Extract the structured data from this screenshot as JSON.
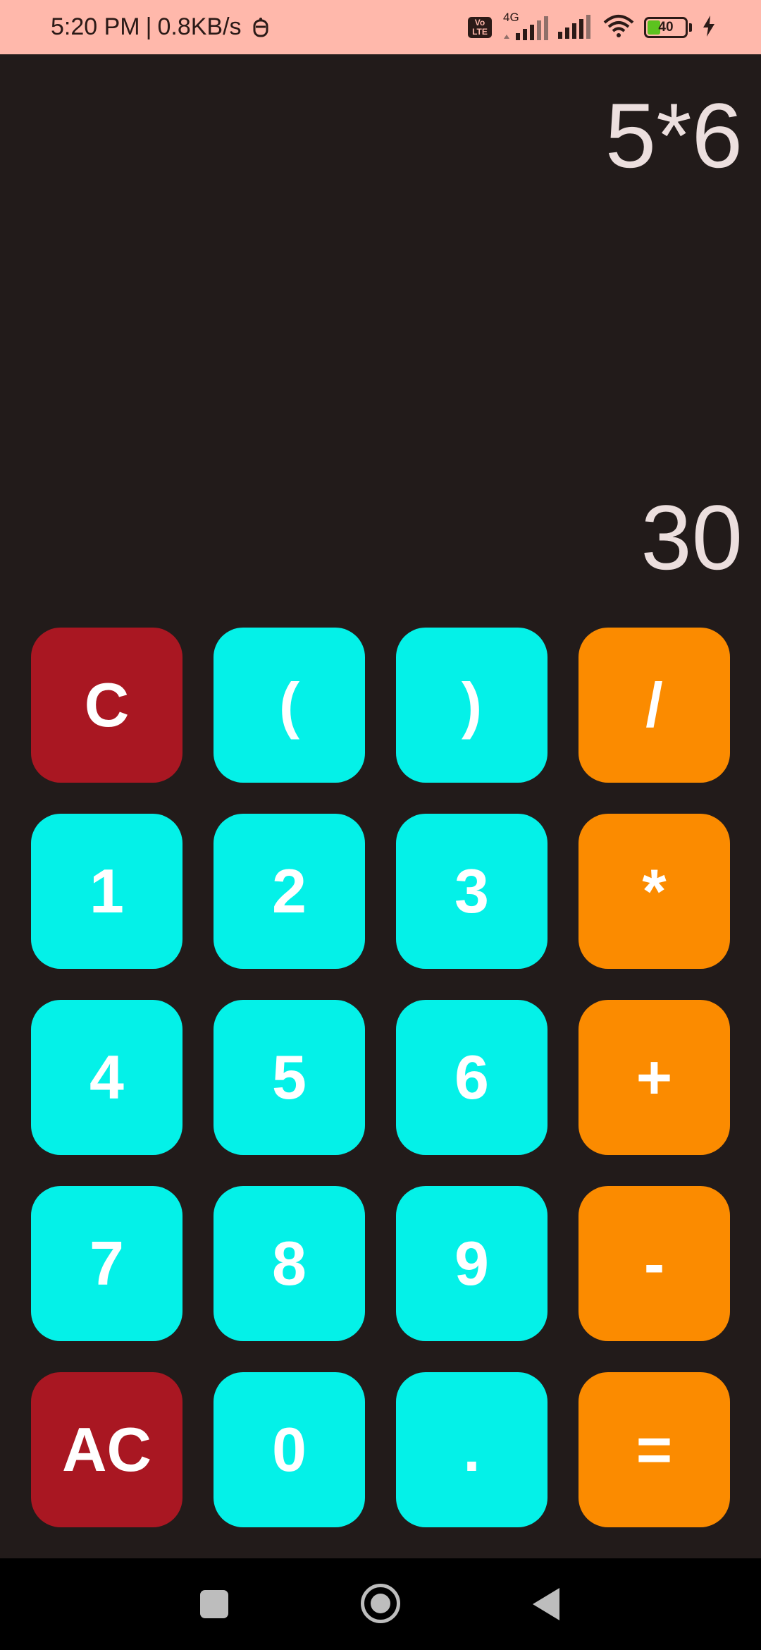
{
  "status_bar": {
    "time": "5:20 PM",
    "separator": "|",
    "speed": "0.8KB/s",
    "icons": [
      "notification-icon",
      "volte-icon",
      "signal-4g-icon",
      "signal-icon",
      "wifi-icon",
      "battery-icon",
      "charging-icon"
    ],
    "volte_top": "Vo",
    "volte_bottom": "LTE",
    "network": "4G",
    "battery_level": "40",
    "battery_fraction": 0.4,
    "background_color": "#ffb8ab"
  },
  "display": {
    "expression": "5*6",
    "result": "30",
    "background_color": "#221b1a",
    "text_color": "#ecdfde"
  },
  "keypad": {
    "colors": {
      "red": "#a91722",
      "cyan": "#04f1e8",
      "orange": "#fb8b00"
    },
    "rows": [
      [
        "C",
        "(",
        ")",
        "/"
      ],
      [
        "1",
        "2",
        "3",
        "*"
      ],
      [
        "4",
        "5",
        "6",
        "+"
      ],
      [
        "7",
        "8",
        "9",
        "-"
      ],
      [
        "AC",
        "0",
        ".",
        "="
      ]
    ]
  },
  "nav_bar": {
    "icons": [
      "recents-icon",
      "home-icon",
      "back-icon"
    ]
  }
}
